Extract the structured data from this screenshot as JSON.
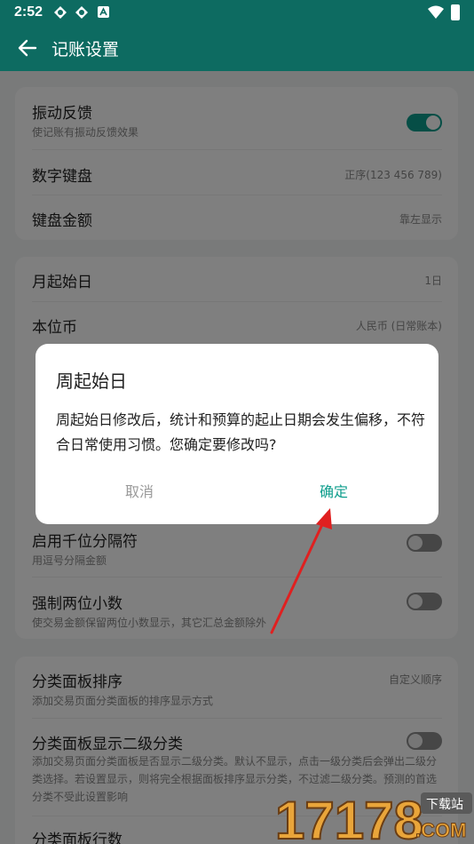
{
  "status_bar": {
    "time": "2:52"
  },
  "app_bar": {
    "title": "记账设置"
  },
  "card1": {
    "items": [
      {
        "label": "振动反馈",
        "sub": "使记账有振动反馈效果",
        "toggle": "on"
      },
      {
        "label": "数字键盘",
        "value": "正序(123 456 789)"
      },
      {
        "label": "键盘金额",
        "value": "靠左显示"
      }
    ]
  },
  "card2": {
    "items": [
      {
        "label": "月起始日",
        "value": "1日"
      },
      {
        "label": "本位币",
        "value": "人民币 (日常账本)"
      },
      {
        "label": "启用千位分隔符",
        "sub": "用逗号分隔金额",
        "toggle": "off"
      },
      {
        "label": "强制两位小数",
        "sub": "使交易金额保留两位小数显示，其它汇总金额除外",
        "toggle": "off"
      }
    ]
  },
  "card3": {
    "items": [
      {
        "label": "分类面板排序",
        "sub": "添加交易页面分类面板的排序显示方式",
        "value": "自定义顺序"
      },
      {
        "label": "分类面板显示二级分类",
        "sub": "添加交易页面分类面板是否显示二级分类。默认不显示，点击一级分类后会弹出二级分类选择。若设置显示，则将完全根据面板排序显示分类，不过滤二级分类。预测的首选分类不受此设置影响",
        "toggle": "off"
      },
      {
        "label": "分类面板行数"
      }
    ]
  },
  "dialog": {
    "title": "周起始日",
    "message": "周起始日修改后，统计和预算的起止日期会发生偏移，不符合日常使用习惯。您确定要修改吗?",
    "cancel_label": "取消",
    "confirm_label": "确定"
  },
  "watermark": {
    "text": "17178",
    "badge": "下载站",
    "domain": ".COM"
  },
  "colors": {
    "primary": "#0d6b61",
    "accent": "#0d9d8c",
    "annotation_arrow": "#e02020"
  }
}
